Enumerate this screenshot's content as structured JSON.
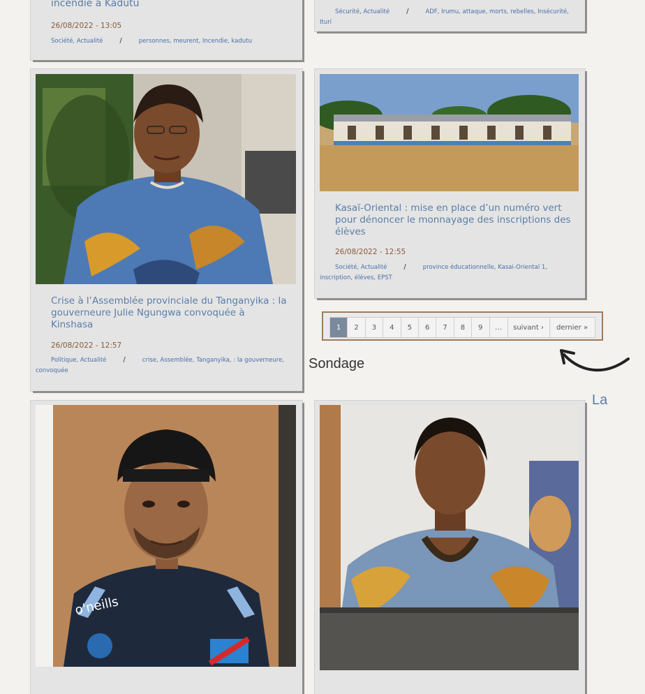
{
  "card1": {
    "title": "incendie à Kadutu",
    "date": "26/08/2022 - 13:05",
    "categories": "Société, Actualité",
    "separator": "/",
    "tags": "personnes, meurent, Incendie, kadutu"
  },
  "card2": {
    "categories": "Sécurité, Actualité",
    "separator": "/",
    "tags": "ADF, Irumu, attaque, morts, rebelles, Insécurité, Ituri"
  },
  "card3": {
    "title": "Crise à l’Assemblée provinciale du Tanganyika : la gouverneure Julie Ngungwa convoquée à Kinshasa",
    "date": "26/08/2022 - 12:57",
    "categories": "Politique, Actualité",
    "separator": "/",
    "tags": "crise, Assemblée, Tanganyika, : la gouverneure, convoquée"
  },
  "card4": {
    "title": "Kasaï-Oriental : mise en place d’un numéro vert pour dénoncer le monnayage des inscriptions des élèves",
    "date": "26/08/2022 - 12:55",
    "categories": "Société, Actualité",
    "separator": "/",
    "tags": "province éducationnelle, Kasai-Oriental 1, inscription, élèves, EPST"
  },
  "pager": {
    "pages": [
      "1",
      "2",
      "3",
      "4",
      "5",
      "6",
      "7",
      "8",
      "9"
    ],
    "dots": "…",
    "next": "suivant ›",
    "last": "dernier »"
  },
  "sidebar": {
    "sondage": "Sondage",
    "la": "La"
  },
  "colors": {
    "link": "#5a7ea8",
    "date": "#8a5a3a",
    "active_page": "#7a8a9c"
  }
}
